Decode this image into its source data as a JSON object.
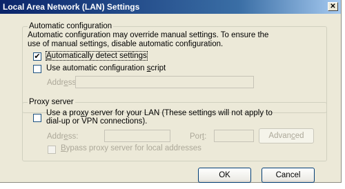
{
  "window": {
    "title": "Local Area Network (LAN) Settings",
    "close_glyph": "✕"
  },
  "auto_config": {
    "legend": "Automatic configuration",
    "description_line1": "Automatic configuration may override manual settings.  To ensure the",
    "description_line2": "use of manual settings, disable automatic configuration.",
    "auto_detect": {
      "label_pre": "",
      "label_u": "A",
      "label_post": "utomatically detect settings",
      "checked": true,
      "check_glyph": "✔"
    },
    "use_script": {
      "label_pre": "Use automatic configuration ",
      "label_u": "s",
      "label_post": "cript",
      "checked": false
    },
    "address": {
      "label_pre": "Addr",
      "label_u": "e",
      "label_post": "ss",
      "value": ""
    }
  },
  "proxy": {
    "legend": "Proxy server",
    "use_proxy": {
      "line1_pre": "Use a pro",
      "line1_u": "x",
      "line1_post": "y server for your LAN (These settings will not apply to",
      "line2": "dial-up or VPN connections).",
      "checked": false
    },
    "address": {
      "label_pre": "Addr",
      "label_u": "e",
      "label_post": "ss:",
      "value": ""
    },
    "port": {
      "label_pre": "Por",
      "label_u": "t",
      "label_post": ":",
      "value": ""
    },
    "advanced": {
      "label_pre": "Advan",
      "label_u": "c",
      "label_post": "ed"
    },
    "bypass": {
      "label_pre": "",
      "label_u": "B",
      "label_post": "ypass proxy server for local addresses",
      "checked": false
    }
  },
  "buttons": {
    "ok": "OK",
    "cancel": "Cancel"
  }
}
